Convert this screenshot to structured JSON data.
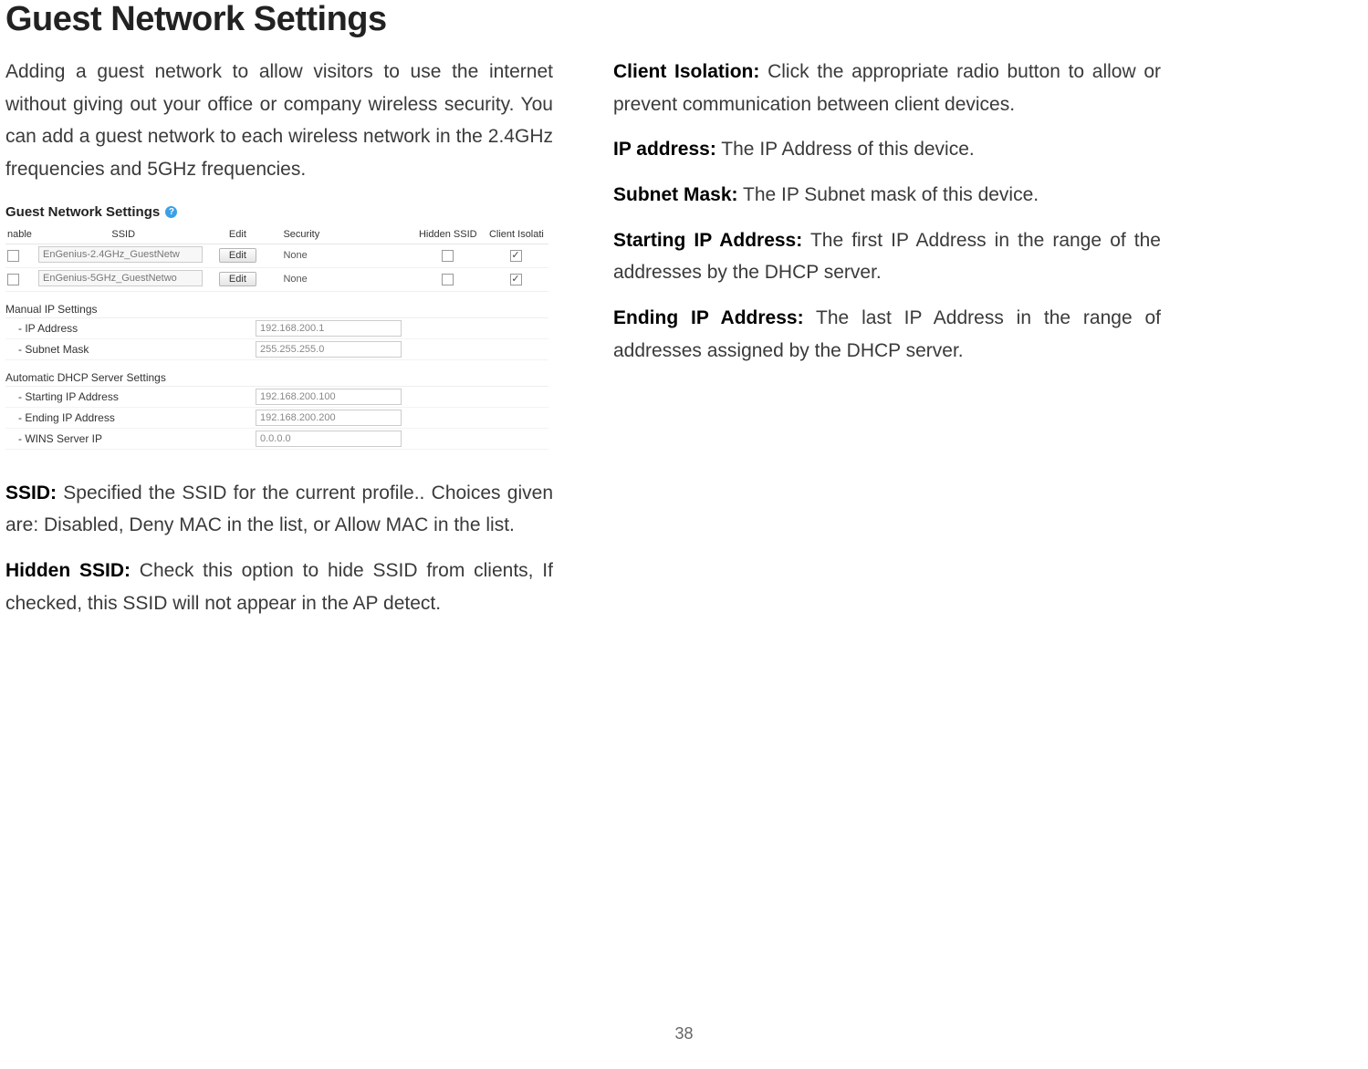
{
  "title": "Guest Network Settings",
  "page_number": "38",
  "left": {
    "intro": "Adding a guest network to allow visitors to use the internet without giving out your office or company wireless security. You can add a guest network to each wireless network in the 2.4GHz frequencies and 5GHz frequencies.",
    "para_ssid": {
      "label": "SSID:",
      "text": " Specified the SSID for the current profile.. Choices given are: Disabled, Deny MAC in the list, or Allow MAC in the list."
    },
    "para_hidden": {
      "label": "Hidden SSID:",
      "text": " Check this option to hide SSID from clients, If checked, this SSID will not appear in the AP detect."
    }
  },
  "right": {
    "para_isolation": {
      "label": "Client Isolation:",
      "text": " Click the appropriate radio button to allow or prevent communication between client devices."
    },
    "para_ip": {
      "label": "IP address:",
      "text": " The IP Address of this device."
    },
    "para_subnet": {
      "label": "Subnet Mask:",
      "text": " The IP Subnet mask of this device."
    },
    "para_start": {
      "label": "Starting IP Address:",
      "text": " The first IP Address in the range of the addresses by the DHCP server."
    },
    "para_end": {
      "label": "Ending IP Address:",
      "text": " The last IP Address in the range of addresses assigned by the DHCP server."
    }
  },
  "panel": {
    "title_partial": "Guest Network Settings",
    "info_icon": "info-icon",
    "headers": {
      "enable": "nable",
      "ssid": "SSID",
      "edit": "Edit",
      "security": "Security",
      "hidden": "Hidden SSID",
      "isolation": "Client Isolati"
    },
    "rows": [
      {
        "enable": false,
        "ssid": "EnGenius-2.4GHz_GuestNetw",
        "edit": "Edit",
        "security": "None",
        "hidden": false,
        "isolation": true
      },
      {
        "enable": false,
        "ssid": "EnGenius-5GHz_GuestNetwo",
        "edit": "Edit",
        "security": "None",
        "hidden": false,
        "isolation": true
      }
    ],
    "manual_section": "Manual IP Settings",
    "manual": {
      "ip_label": "- IP Address",
      "ip_value": "192.168.200.1",
      "subnet_label": "- Subnet Mask",
      "subnet_value": "255.255.255.0"
    },
    "dhcp_section": "Automatic DHCP Server Settings",
    "dhcp": {
      "start_label": "- Starting IP Address",
      "start_value": "192.168.200.100",
      "end_label": "- Ending IP Address",
      "end_value": "192.168.200.200",
      "wins_label": "- WINS Server IP",
      "wins_value": "0.0.0.0"
    }
  }
}
